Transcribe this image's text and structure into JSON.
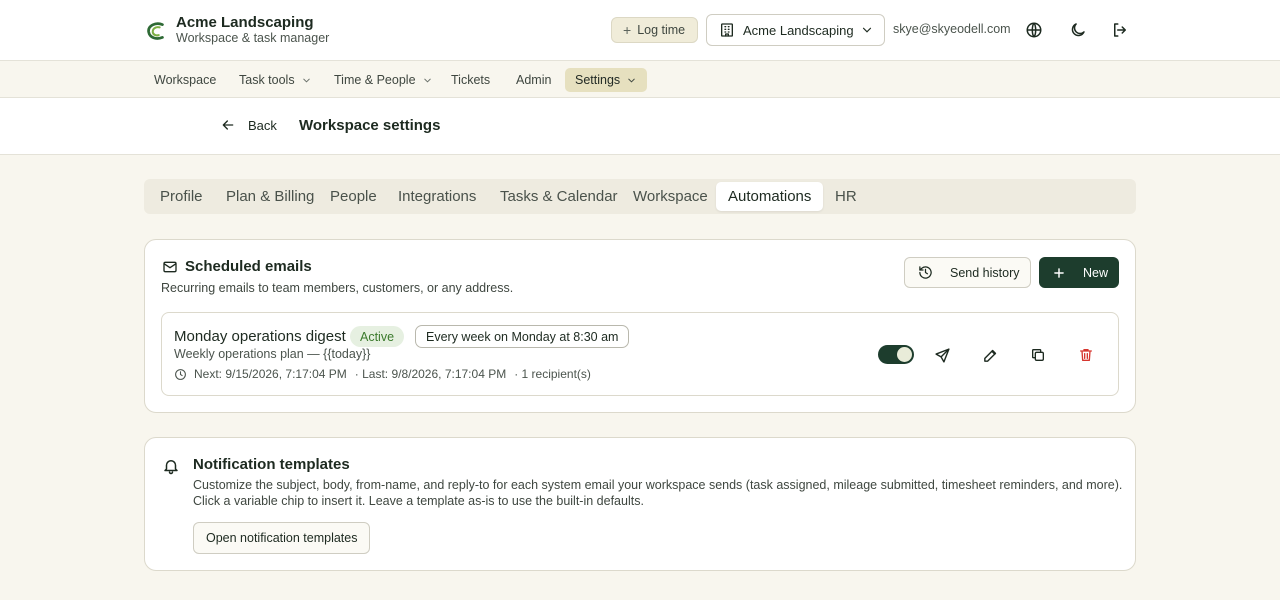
{
  "brand": {
    "title": "Acme Landscaping",
    "subtitle": "Workspace & task manager"
  },
  "topbar": {
    "log_time_label": "Log time",
    "workspace_selected": "Acme Landscaping",
    "user_email": "skye@skyeodell.com"
  },
  "nav": {
    "items": [
      {
        "label": "Workspace"
      },
      {
        "label": "Task tools"
      },
      {
        "label": "Time & People"
      },
      {
        "label": "Tickets"
      },
      {
        "label": "Admin"
      },
      {
        "label": "Settings"
      }
    ]
  },
  "subheader": {
    "back_label": "Back",
    "title": "Workspace settings"
  },
  "tabs": [
    {
      "label": "Profile"
    },
    {
      "label": "Plan & Billing"
    },
    {
      "label": "People"
    },
    {
      "label": "Integrations"
    },
    {
      "label": "Tasks & Calendar"
    },
    {
      "label": "Workspace"
    },
    {
      "label": "Automations",
      "active": true
    },
    {
      "label": "HR"
    }
  ],
  "scheduled_emails": {
    "title": "Scheduled emails",
    "description": "Recurring emails to team members, customers, or any address.",
    "send_history_label": "Send history",
    "new_label": "New",
    "items": [
      {
        "name": "Monday operations digest",
        "status": "Active",
        "schedule": "Every week on Monday at 8:30 am",
        "subject": "Weekly operations plan — {{today}}",
        "next": "Next: 9/15/2026, 7:17:04 PM",
        "last": "· Last: 9/8/2026, 7:17:04 PM",
        "recipients": "· 1 recipient(s)",
        "enabled": true
      }
    ]
  },
  "notification_templates": {
    "title": "Notification templates",
    "description_line1": "Customize the subject, body, from-name, and reply-to for each system email your workspace sends (task assigned, mileage submitted, timesheet reminders, and more).",
    "description_line2": "Click a variable chip to insert it. Leave a template as-is to use the built-in defaults.",
    "button_label": "Open notification templates"
  },
  "colors": {
    "accent": "#1d3d2d",
    "background": "#f8f6ee",
    "active_badge_bg": "#e6f0e1",
    "active_badge_text": "#3b7a2c",
    "danger": "#d6362f",
    "nav_active_bg": "#e6e0bf"
  }
}
